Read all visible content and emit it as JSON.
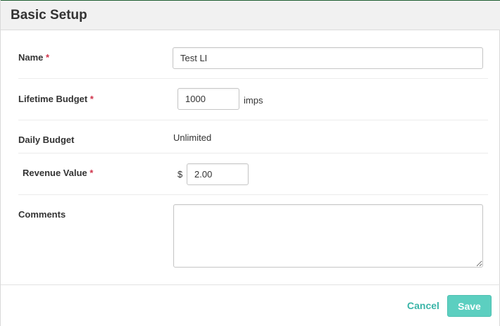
{
  "dialog": {
    "title": "Basic Setup"
  },
  "form": {
    "required_marker": "*",
    "name": {
      "label": "Name",
      "value": "Test LI"
    },
    "lifetime_budget": {
      "label": "Lifetime Budget",
      "value": "1000",
      "unit": "imps"
    },
    "daily_budget": {
      "label": "Daily Budget",
      "value": "Unlimited"
    },
    "revenue_value": {
      "label": "Revenue Value",
      "currency": "$",
      "value": "2.00"
    },
    "comments": {
      "label": "Comments",
      "value": ""
    }
  },
  "footer": {
    "cancel_label": "Cancel",
    "save_label": "Save"
  },
  "colors": {
    "accent": "#5ccfc0",
    "link": "#3bb5a8",
    "required": "#d0334a"
  }
}
